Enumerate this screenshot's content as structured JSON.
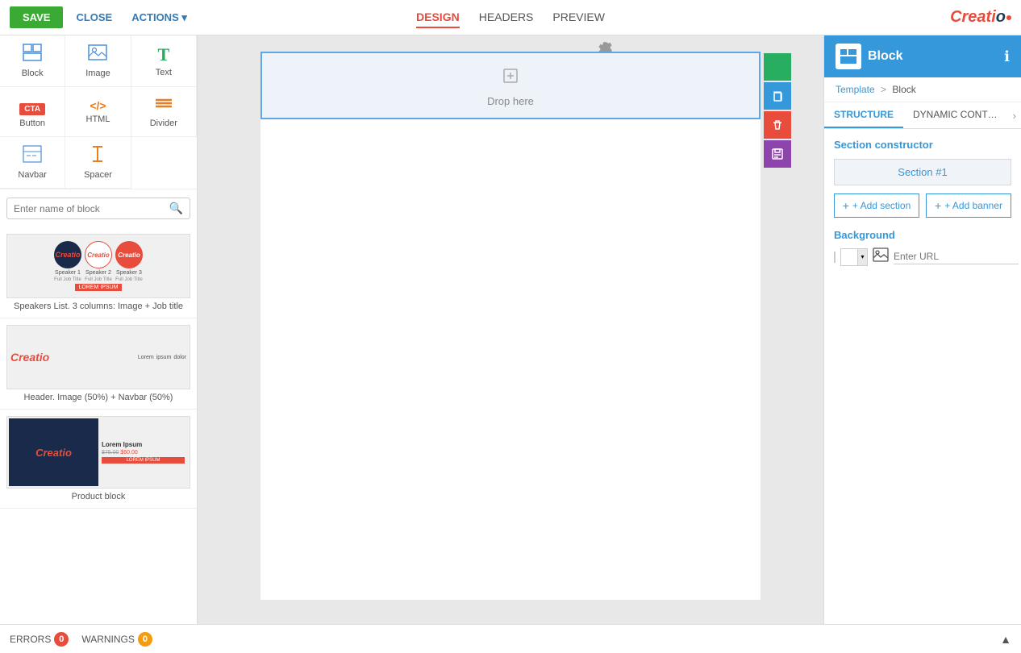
{
  "topbar": {
    "save_label": "SAVE",
    "close_label": "CLOSE",
    "actions_label": "ACTIONS",
    "tabs": [
      {
        "id": "design",
        "label": "DESIGN",
        "active": true
      },
      {
        "id": "headers",
        "label": "HEADERS",
        "active": false
      },
      {
        "id": "preview",
        "label": "PREVIEW",
        "active": false
      }
    ],
    "logo": "Creatio"
  },
  "left_sidebar": {
    "components": [
      {
        "id": "block",
        "label": "Block",
        "icon": "⊞"
      },
      {
        "id": "image",
        "label": "Image",
        "icon": "🖼"
      },
      {
        "id": "text",
        "label": "Text",
        "icon": "T"
      },
      {
        "id": "button",
        "label": "Button",
        "icon": "CTA"
      },
      {
        "id": "html",
        "label": "HTML",
        "icon": "</>"
      },
      {
        "id": "divider",
        "label": "Divider",
        "icon": "≡"
      },
      {
        "id": "navbar",
        "label": "Navbar",
        "icon": "☰"
      },
      {
        "id": "spacer",
        "label": "Spacer",
        "icon": "⇕"
      }
    ],
    "search_placeholder": "Enter name of block",
    "templates": [
      {
        "id": "speakers",
        "label": "Speakers List. 3 columns: Image + Job title",
        "type": "speakers"
      },
      {
        "id": "header",
        "label": "Header. Image (50%) + Navbar (50%)",
        "type": "header"
      },
      {
        "id": "product",
        "label": "Product block",
        "type": "product"
      }
    ]
  },
  "canvas": {
    "drop_here_text": "Drop here",
    "settings_icon": "⚙"
  },
  "right_panel": {
    "title": "Block",
    "breadcrumb": {
      "template_label": "Template",
      "separator": ">",
      "block_label": "Block"
    },
    "tabs": [
      {
        "id": "structure",
        "label": "STRUCTURE",
        "active": true
      },
      {
        "id": "dynamic_content",
        "label": "DYNAMIC CONT…",
        "active": false
      }
    ],
    "section_constructor_label": "Section constructor",
    "section_item_label": "Section #1",
    "add_section_label": "+ Add section",
    "add_banner_label": "+ Add banner",
    "background_label": "Background",
    "bg_url_placeholder": "Enter URL"
  },
  "bottom_bar": {
    "errors_label": "ERRORS",
    "errors_count": "0",
    "warnings_label": "WARNINGS",
    "warnings_count": "0"
  }
}
